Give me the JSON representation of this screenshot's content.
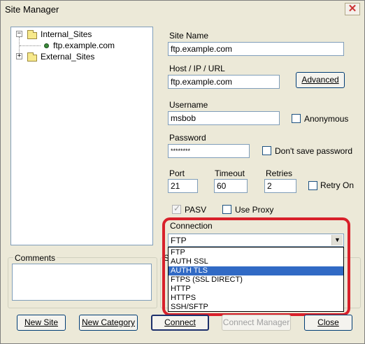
{
  "window": {
    "title": "Site Manager",
    "close_glyph": "✕"
  },
  "tree": {
    "nodes": [
      {
        "label": "Internal_Sites",
        "expander": "−"
      },
      {
        "label": "ftp.example.com"
      },
      {
        "label": "External_Sites",
        "expander": "+"
      }
    ]
  },
  "form": {
    "site_name_label": "Site Name",
    "site_name_value": "ftp.example.com",
    "host_label": "Host / IP / URL",
    "host_value": "ftp.example.com",
    "advanced_label": "Advanced",
    "username_label": "Username",
    "username_value": "msbob",
    "anonymous_label": "Anonymous",
    "password_label": "Password",
    "password_value": "********",
    "dont_save_label": "Don't save password",
    "port_label": "Port",
    "port_value": "21",
    "timeout_label": "Timeout",
    "timeout_value": "60",
    "retries_label": "Retries",
    "retries_value": "2",
    "retry_on_label": "Retry On",
    "pasv_label": "PASV",
    "use_proxy_label": "Use Proxy",
    "connection_label": "Connection",
    "connection_value": "FTP",
    "connection_options": [
      "FTP",
      "AUTH SSL",
      "AUTH TLS",
      "FTPS (SSL DIRECT)",
      "HTTP",
      "HTTPS",
      "SSH/SFTP"
    ],
    "connection_highlighted_index": 2,
    "partial_label": "S"
  },
  "comments": {
    "label": "Comments"
  },
  "buttons": {
    "new_site": "New Site",
    "new_category": "New Category",
    "connect": "Connect",
    "connect_manager": "Connect Manager",
    "close": "Close"
  },
  "icons": {
    "folder": "folder-icon",
    "site": "site-icon",
    "checkbox_checked": "✓",
    "dropdown_arrow": "▼"
  },
  "colors": {
    "highlight_border": "#d8202a",
    "selection": "#316ac5",
    "dialog_bg": "#ece9d8"
  }
}
